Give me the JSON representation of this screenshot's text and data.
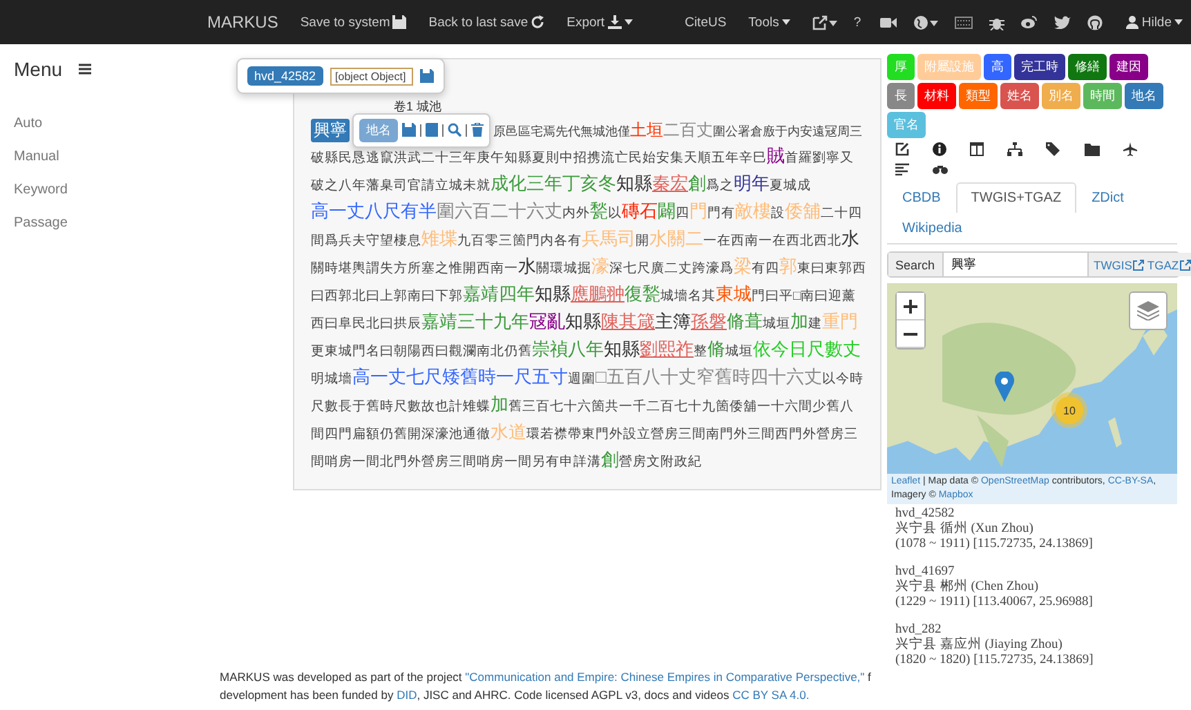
{
  "navbar": {
    "brand": "MARKUS",
    "items": [
      {
        "kind": "save",
        "label": "Save to system"
      },
      {
        "kind": "revert",
        "label": "Back to last save"
      },
      {
        "kind": "export",
        "label": "Export"
      }
    ],
    "cite": "CiteUS",
    "tools": "Tools",
    "help": "?",
    "user": "Hilde"
  },
  "sidebar": {
    "title": "Menu",
    "items": [
      "Auto",
      "Manual",
      "Keyword",
      "Passage"
    ]
  },
  "popover_id": {
    "badge": "hvd_42582",
    "value": "[object Object]"
  },
  "popover_tag": {
    "badge": "地名"
  },
  "heading": "卷1 城池",
  "selected_term": "興寧",
  "first_line": [
    {
      "kind": "plain",
      "text": "原邑區宅焉先代無城池僅"
    },
    {
      "kind": "tag",
      "text": "土垣",
      "color": "#ff3300",
      "underlined": false
    },
    {
      "kind": "tag",
      "text": "二百丈",
      "color": "#888888",
      "underlined": false
    },
    {
      "kind": "plain",
      "text": "圍公署倉廒于内安遠冦周三"
    }
  ],
  "segments": [
    {
      "kind": "plain",
      "text": "破縣民恳逃竄洪武二十三年庚午知縣夏則中招携流亡民始安集天順五年辛巳"
    },
    {
      "kind": "tag",
      "text": "賊",
      "color": "#880088",
      "underlined": false
    },
    {
      "kind": "plain",
      "text": "首羅劉寧又破之八年藩臬司官請立城未就"
    },
    {
      "kind": "tag",
      "text": "成化三年丁亥冬",
      "color": "#3a9a3a",
      "underlined": false
    },
    {
      "kind": "tag",
      "text": "知縣",
      "color": "#333333",
      "underlined": false
    },
    {
      "kind": "tag",
      "text": "秦宏",
      "color": "#e0605a",
      "underlined": true
    },
    {
      "kind": "tag",
      "text": "創",
      "color": "#3a9a3a",
      "underlined": false
    },
    {
      "kind": "plain",
      "text": "爲之"
    },
    {
      "kind": "tag",
      "text": "明年",
      "color": "#333399",
      "underlined": false
    },
    {
      "kind": "plain",
      "text": "夏城成"
    },
    {
      "kind": "tag",
      "text": "高一丈八尺有半",
      "color": "#3366ff",
      "underlined": false
    },
    {
      "kind": "tag",
      "text": "圍六百二十六丈",
      "color": "#888888",
      "underlined": false
    },
    {
      "kind": "plain",
      "text": "内外"
    },
    {
      "kind": "tag",
      "text": "甃",
      "color": "#3a9a3a",
      "underlined": false
    },
    {
      "kind": "plain",
      "text": "以"
    },
    {
      "kind": "tag",
      "text": "磚石",
      "color": "#ff2200",
      "underlined": false
    },
    {
      "kind": "tag",
      "text": "闢",
      "color": "#3a9a3a",
      "underlined": false
    },
    {
      "kind": "plain",
      "text": "四"
    },
    {
      "kind": "tag",
      "text": "門",
      "color": "#ffbb77",
      "underlined": false
    },
    {
      "kind": "plain",
      "text": "門有"
    },
    {
      "kind": "tag",
      "text": "敵樓",
      "color": "#ffbb77",
      "underlined": false
    },
    {
      "kind": "plain",
      "text": "設"
    },
    {
      "kind": "tag",
      "text": "倭舖",
      "color": "#ffbb77",
      "underlined": false
    },
    {
      "kind": "plain",
      "text": "二十四間爲兵夫守望棲息"
    },
    {
      "kind": "tag",
      "text": "雉堞",
      "color": "#ffbb77",
      "underlined": false
    },
    {
      "kind": "plain",
      "text": "九百零三箇門内各有"
    },
    {
      "kind": "tag",
      "text": "兵馬司",
      "color": "#ffbb77",
      "underlined": false
    },
    {
      "kind": "plain",
      "text": "開"
    },
    {
      "kind": "tag",
      "text": "水關二",
      "color": "#ffbb77",
      "underlined": false
    },
    {
      "kind": "plain",
      "text": "一在西南一在西北西北"
    },
    {
      "kind": "tag",
      "text": "水",
      "color": "#333333",
      "underlined": false
    },
    {
      "kind": "plain",
      "text": "關時堪輿謂失方所塞之惟開西南一"
    },
    {
      "kind": "tag",
      "text": "水",
      "color": "#333333",
      "underlined": false
    },
    {
      "kind": "plain",
      "text": "關環城掘"
    },
    {
      "kind": "tag",
      "text": "濠",
      "color": "#ffbb77",
      "underlined": false
    },
    {
      "kind": "plain",
      "text": "深七尺廣二丈跨濠爲"
    },
    {
      "kind": "tag",
      "text": "梁",
      "color": "#ffbb77",
      "underlined": false
    },
    {
      "kind": "plain",
      "text": "有四"
    },
    {
      "kind": "tag",
      "text": "郭",
      "color": "#ffbb77",
      "underlined": false
    },
    {
      "kind": "plain",
      "text": "東曰東郭西曰西郭北曰上郭南曰下郭"
    },
    {
      "kind": "tag",
      "text": "嘉靖四年",
      "color": "#3a9a3a",
      "underlined": false
    },
    {
      "kind": "tag",
      "text": "知縣",
      "color": "#333333",
      "underlined": false
    },
    {
      "kind": "tag",
      "text": "應鵬翀",
      "color": "#e0605a",
      "underlined": true
    },
    {
      "kind": "tag",
      "text": "復",
      "color": "#3a9a3a",
      "underlined": false
    },
    {
      "kind": "tag",
      "text": "甃",
      "color": "#3a9a3a",
      "underlined": false
    },
    {
      "kind": "plain",
      "text": "城墻名其"
    },
    {
      "kind": "tag",
      "text": "東城",
      "color": "#ff5500",
      "underlined": false
    },
    {
      "kind": "plain",
      "text": "門曰平□南曰迎薰西曰阜民北曰拱辰"
    },
    {
      "kind": "tag",
      "text": "嘉靖三十九年",
      "color": "#3a9a3a",
      "underlined": false
    },
    {
      "kind": "tag",
      "text": "冦亂",
      "color": "#880088",
      "underlined": false
    },
    {
      "kind": "tag",
      "text": "知縣",
      "color": "#333333",
      "underlined": false
    },
    {
      "kind": "tag",
      "text": "陳其箴",
      "color": "#e0605a",
      "underlined": true
    },
    {
      "kind": "tag",
      "text": "主簿",
      "color": "#333333",
      "underlined": false
    },
    {
      "kind": "tag",
      "text": "孫磐",
      "color": "#e0605a",
      "underlined": true
    },
    {
      "kind": "tag",
      "text": "脩葺",
      "color": "#3a9a3a",
      "underlined": false
    },
    {
      "kind": "plain",
      "text": "城垣"
    },
    {
      "kind": "tag",
      "text": "加",
      "color": "#3a9a3a",
      "underlined": false
    },
    {
      "kind": "plain",
      "text": "建"
    },
    {
      "kind": "tag",
      "text": "重門",
      "color": "#ffbb77",
      "underlined": false
    },
    {
      "kind": "plain",
      "text": "更東城門名曰朝陽西曰觀瀾南北仍舊"
    },
    {
      "kind": "tag",
      "text": "崇禎八年",
      "color": "#3a9a3a",
      "underlined": false
    },
    {
      "kind": "tag",
      "text": "知縣",
      "color": "#333333",
      "underlined": false
    },
    {
      "kind": "tag",
      "text": "劉熙祚",
      "color": "#e0605a",
      "underlined": true
    },
    {
      "kind": "plain",
      "text": "整"
    },
    {
      "kind": "tag",
      "text": "脩",
      "color": "#3a9a3a",
      "underlined": false
    },
    {
      "kind": "plain",
      "text": "城垣"
    },
    {
      "kind": "tag",
      "text": "依今日尺數丈",
      "color": "#22cc22",
      "underlined": false
    },
    {
      "kind": "plain",
      "text": "明城墻"
    },
    {
      "kind": "tag",
      "text": "高一丈七尺矮舊時一尺五寸",
      "color": "#3366ff",
      "underlined": false
    },
    {
      "kind": "plain",
      "text": "週圍"
    },
    {
      "kind": "tag",
      "text": "□五百八十丈窄舊時四十六丈",
      "color": "#888888",
      "underlined": false
    },
    {
      "kind": "plain",
      "text": "以今時尺數長于舊時尺數故也計雉蝶"
    },
    {
      "kind": "tag",
      "text": "加",
      "color": "#3a9a3a",
      "underlined": false
    },
    {
      "kind": "plain",
      "text": "舊三百七十六箇共一千二百七十九箇倭舖一十六間少舊八間四門扁額仍舊開深濠池通徹"
    },
    {
      "kind": "tag",
      "text": "水道",
      "color": "#ffbb77",
      "underlined": false
    },
    {
      "kind": "plain",
      "text": "環若襟帶東門外設立營房三間南門外三間西門外營房三間哨房一間北門外營房三間哨房一間另有申詳溝"
    },
    {
      "kind": "tag",
      "text": "創",
      "color": "#3a9a3a",
      "underlined": false
    },
    {
      "kind": "plain",
      "text": "營房文附政紀"
    }
  ],
  "tag_buttons": [
    {
      "label": "厚",
      "color": "#22dd22"
    },
    {
      "label": "附屬設施",
      "color": "#ffcc99"
    },
    {
      "label": "高",
      "color": "#3366ff"
    },
    {
      "label": "完工時",
      "color": "#333399"
    },
    {
      "label": "修繕",
      "color": "#117711"
    },
    {
      "label": "建因",
      "color": "#880088"
    },
    {
      "label": "長",
      "color": "#888888"
    },
    {
      "label": "材料",
      "color": "#ff0000"
    },
    {
      "label": "類型",
      "color": "#ff6600"
    },
    {
      "label": "姓名",
      "color": "#d9534f"
    },
    {
      "label": "別名",
      "color": "#f0ad4e"
    },
    {
      "label": "時間",
      "color": "#5cb85c"
    },
    {
      "label": "地名",
      "color": "#337ab7"
    },
    {
      "label": "官名",
      "color": "#5bc0de"
    }
  ],
  "tabs": [
    {
      "label": "CBDB",
      "selected": false
    },
    {
      "label": "TWGIS+TGAZ",
      "selected": true
    },
    {
      "label": "ZDict",
      "selected": false
    },
    {
      "label": "Wikipedia",
      "selected": false
    }
  ],
  "search": {
    "label": "Search",
    "value": "興寧",
    "links": [
      "TWGIS",
      "TGAZ"
    ]
  },
  "map": {
    "cluster": "10",
    "attribution": [
      {
        "kind": "link",
        "text": "Leaflet"
      },
      {
        "kind": "text",
        "text": " | Map data © "
      },
      {
        "kind": "link",
        "text": "OpenStreetMap"
      },
      {
        "kind": "text",
        "text": " contributors, "
      },
      {
        "kind": "link",
        "text": "CC-BY-SA"
      },
      {
        "kind": "text",
        "text": ", Imagery © "
      },
      {
        "kind": "link",
        "text": "Mapbox"
      }
    ]
  },
  "results": [
    {
      "id": "hvd_42582",
      "name": "兴宁县 循州 (Xun Zhou)",
      "detail": "(1078 ~ 1911) [115.72735, 24.13869]"
    },
    {
      "id": "hvd_41697",
      "name": "兴宁县 郴州 (Chen Zhou)",
      "detail": "(1229 ~ 1911) [113.40067, 25.96988]"
    },
    {
      "id": "hvd_282",
      "name": "兴宁县 嘉应州 (Jiaying Zhou)",
      "detail": "(1820 ~ 1820) [115.72735, 24.13869]"
    }
  ],
  "footer": {
    "line1": [
      {
        "kind": "text",
        "text": "MARKUS was developed as part of the project "
      },
      {
        "kind": "link",
        "text": "\"Communication and Empire: Chinese Empires in Comparative Perspective,\""
      },
      {
        "kind": "text",
        "text": " f"
      }
    ],
    "line2": [
      {
        "kind": "text",
        "text": "development has been funded by "
      },
      {
        "kind": "link",
        "text": "DID"
      },
      {
        "kind": "text",
        "text": ", JISC and AHRC. Code licensed AGPL v3, docs and videos "
      },
      {
        "kind": "link",
        "text": "CC BY SA 4.0."
      }
    ]
  }
}
